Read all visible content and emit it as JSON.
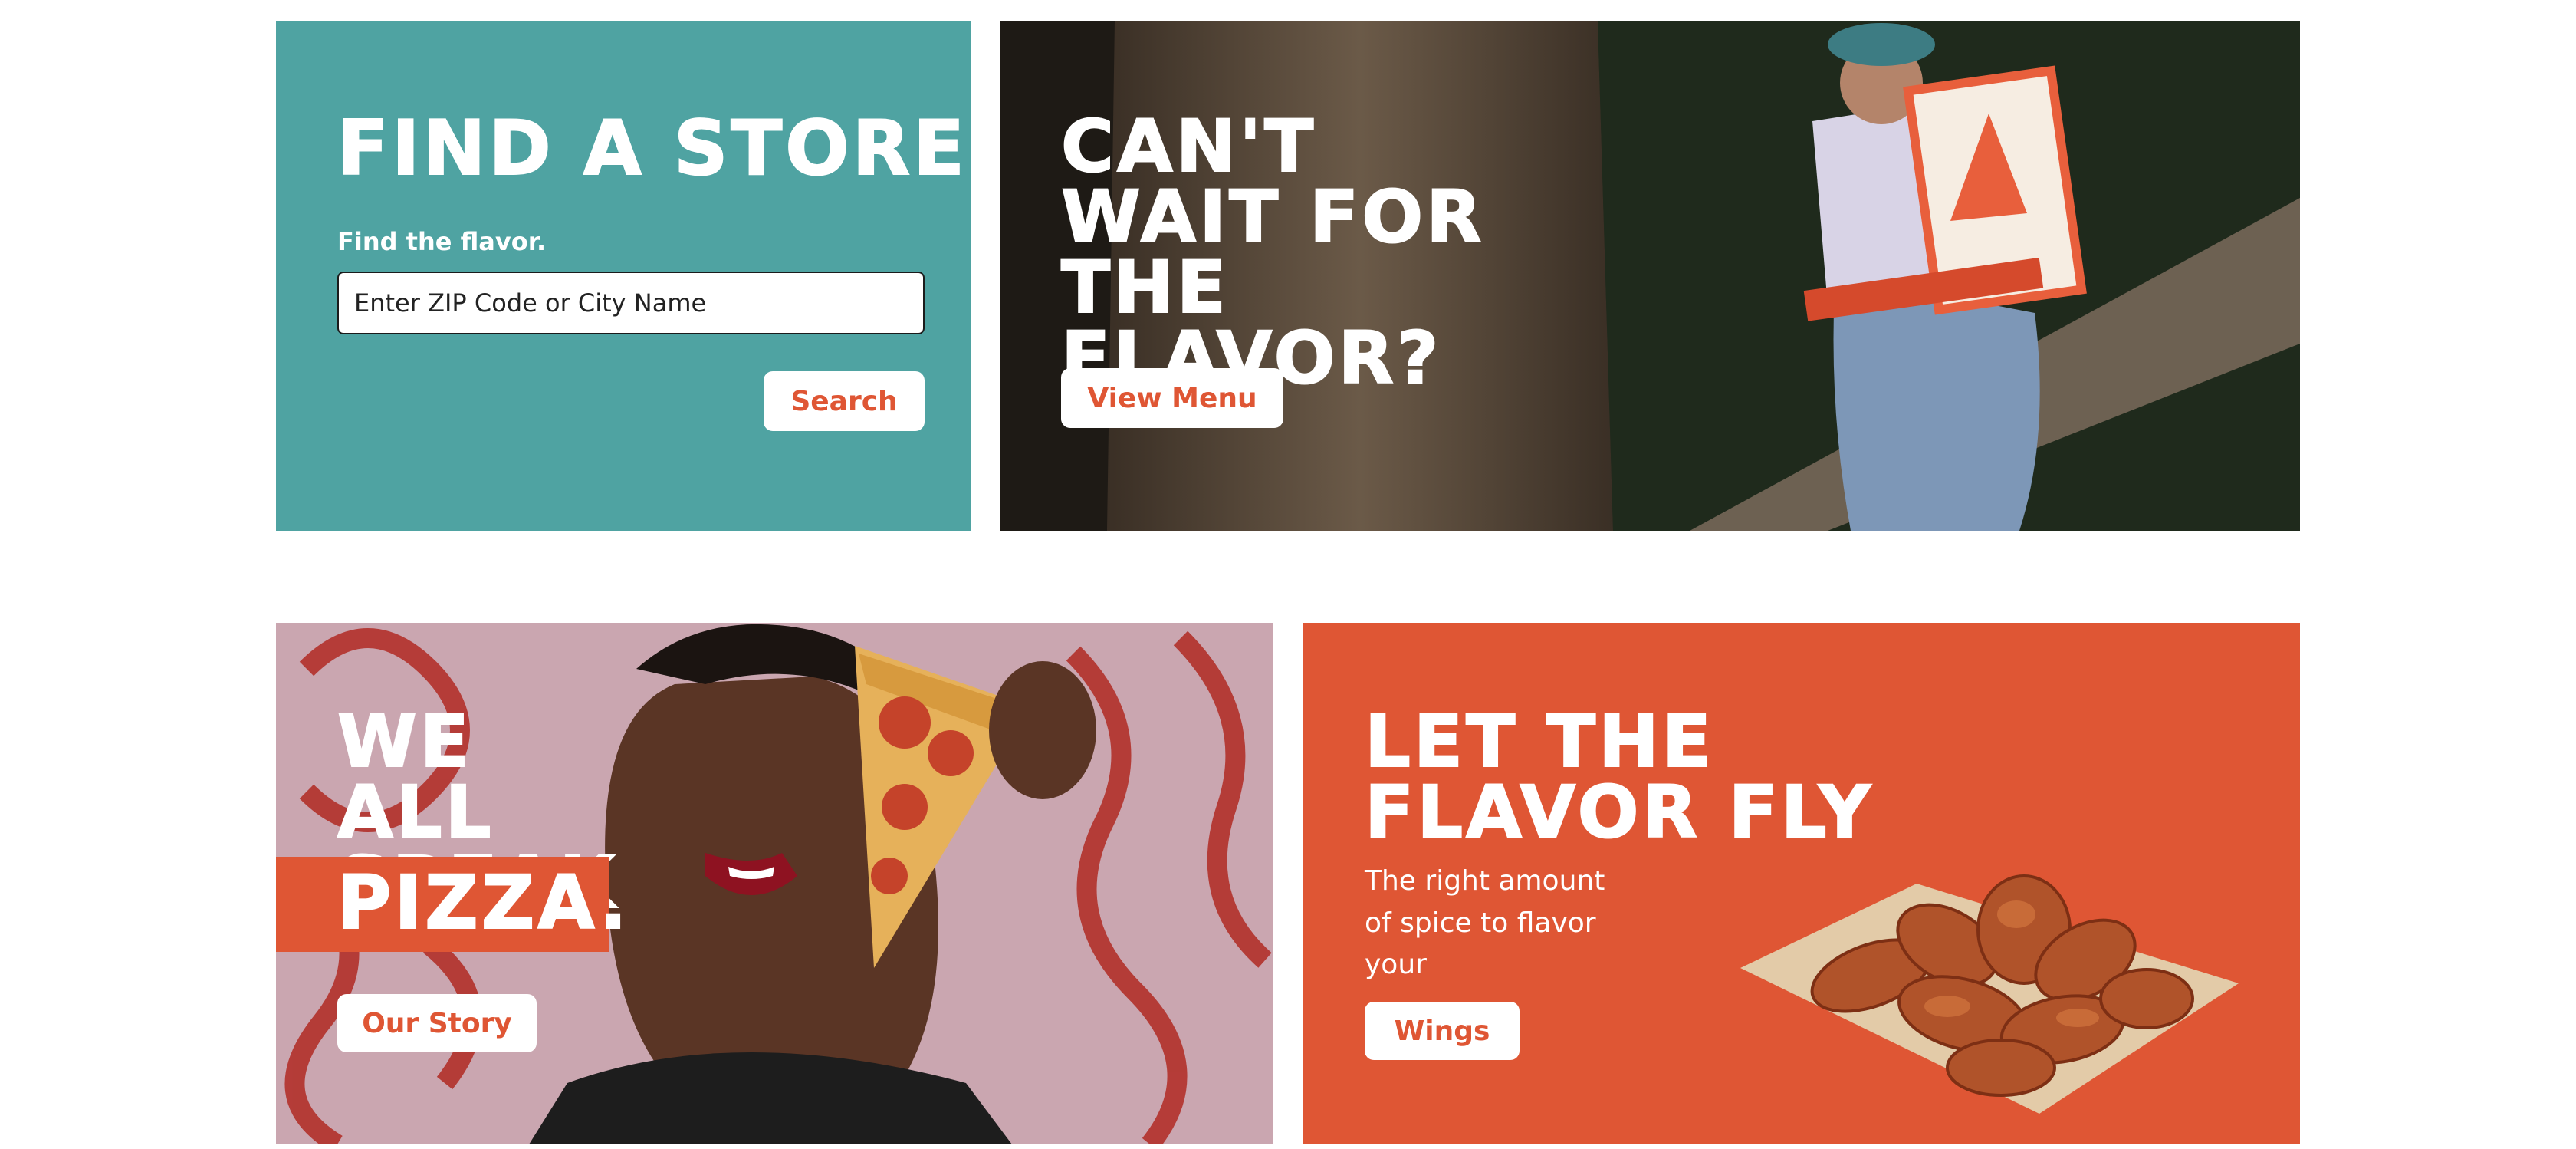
{
  "find_store": {
    "title": "FIND A STORE",
    "subtitle": "Find the flavor.",
    "input_placeholder": "Enter ZIP Code or City Name",
    "search_label": "Search"
  },
  "menu_promo": {
    "title": "CAN'T WAIT FOR THE FLAVOR?",
    "button_label": "View Menu"
  },
  "story_promo": {
    "title_line1": "WE ALL SPEAK",
    "title_line2": "PIZZA.",
    "button_label": "Our Story"
  },
  "wings_promo": {
    "title": "LET THE FLAVOR FLY",
    "description": "The right amount of spice to flavor your",
    "button_label": "Wings"
  },
  "colors": {
    "teal": "#4fa3a2",
    "orange": "#df5634",
    "white": "#ffffff"
  },
  "icons": {
    "pizza_box": "pizza-box-icon",
    "wings_plate": "chicken-wings-icon",
    "pizza_slice": "pizza-slice-icon"
  }
}
